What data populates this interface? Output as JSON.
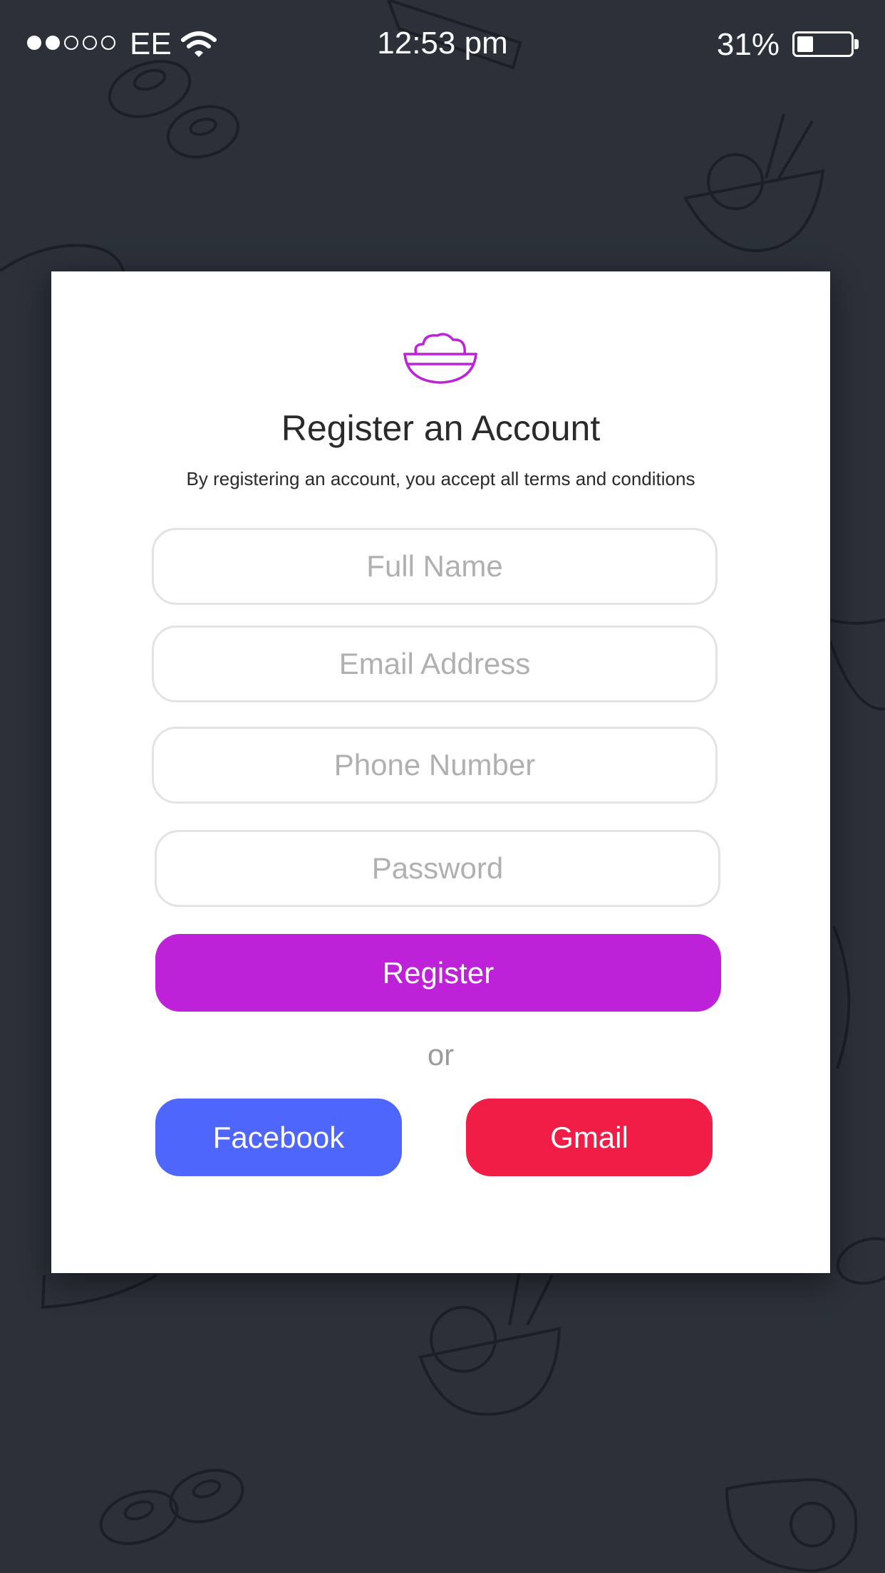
{
  "status_bar": {
    "signal": [
      "full",
      "full",
      "empty",
      "empty",
      "empty"
    ],
    "carrier": "EE",
    "time": "12:53 pm",
    "battery_percent": "31%",
    "battery_level": 0.31
  },
  "icons": {
    "wifi": "wifi-icon",
    "battery": "battery-icon",
    "logo": "rice-bowl-icon"
  },
  "colors": {
    "background": "#2b3039",
    "register_button": "#bd22d9",
    "facebook_button": "#4e66fb",
    "gmail_button": "#f01e46",
    "logo": "#bd22d9"
  },
  "register": {
    "title": "Register an Account",
    "subtitle": "By registering an account, you accept all terms and conditions",
    "fields": {
      "full_name": {
        "placeholder": "Full Name",
        "value": ""
      },
      "email": {
        "placeholder": "Email Address",
        "value": ""
      },
      "phone": {
        "placeholder": "Phone Number",
        "value": ""
      },
      "password": {
        "placeholder": "Password",
        "value": ""
      }
    },
    "register_label": "Register",
    "or_label": "or",
    "facebook_label": "Facebook",
    "gmail_label": "Gmail"
  }
}
